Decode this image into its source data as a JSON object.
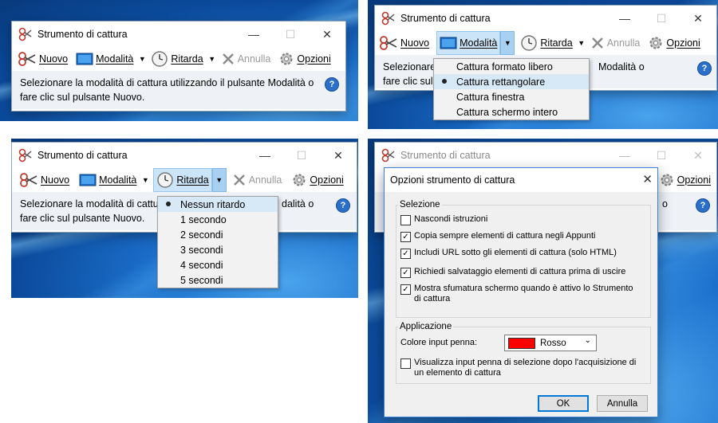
{
  "app": {
    "title": "Strumento di cattura",
    "close_glyph": "✕",
    "minimize_glyph": "—",
    "maximize_glyph": "☐"
  },
  "toolbar": {
    "nuovo": "Nuovo",
    "modalita": "Modalità",
    "ritarda": "Ritarda",
    "annulla": "Annulla",
    "opzioni": "Opzioni",
    "dropdown_glyph": "▼"
  },
  "message": {
    "line1": "Selezionare la modalità di cattura utilizzando il pulsante Modalità o",
    "line2": "fare clic sul pulsante Nuovo.",
    "partial1_tr": "Selezionare",
    "partial2_tr": "fare clic sul",
    "tail1_tr": "Modalità o",
    "partial1_bl": "Selezionare la modalità di cattu",
    "partial2_bl": "fare clic sul pulsante Nuovo.",
    "tail1_bl": "dalità o",
    "tail1_br": "o",
    "help_glyph": "?"
  },
  "mode_menu": {
    "items": [
      "Cattura formato libero",
      "Cattura rettangolare",
      "Cattura finestra",
      "Cattura schermo intero"
    ],
    "selected_index": 1
  },
  "delay_menu": {
    "items": [
      "Nessun ritardo",
      "1 secondo",
      "2 secondi",
      "3 secondi",
      "4 secondi",
      "5 secondi"
    ],
    "selected_index": 0
  },
  "options_dialog": {
    "title": "Opzioni strumento di cattura",
    "close_glyph": "✕",
    "selezione_label": "Selezione",
    "checkboxes": [
      {
        "label": "Nascondi istruzioni",
        "checked": false
      },
      {
        "label": "Copia sempre elementi di cattura negli Appunti",
        "checked": true
      },
      {
        "label": "Includi URL sotto gli elementi di cattura (solo HTML)",
        "checked": true
      },
      {
        "label": "Richiedi salvataggio elementi di cattura prima di uscire",
        "checked": true
      },
      {
        "label": "Mostra sfumatura schermo quando è attivo lo Strumento di cattura",
        "checked": true
      }
    ],
    "applicazione_label": "Applicazione",
    "pen_color_label": "Colore input penna:",
    "pen_color_value": "Rosso",
    "pen_color_hex": "#ff0000",
    "pen_checkbox": {
      "label": "Visualizza input penna di selezione dopo l'acquisizione di un elemento di cattura",
      "checked": false
    },
    "ok_label": "OK",
    "cancel_label": "Annulla",
    "check_glyph": "✓"
  }
}
